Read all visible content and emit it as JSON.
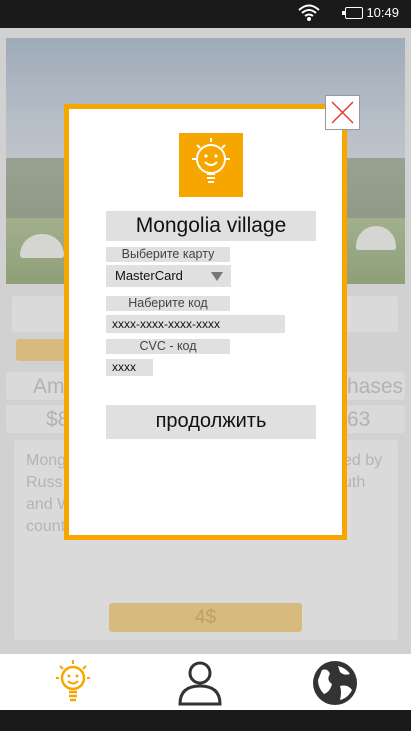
{
  "status_bar": {
    "time": "10:49",
    "icons": [
      "wifi-icon",
      "battery-icon"
    ]
  },
  "background": {
    "image": "mongolia-yurt-landscape",
    "stats_left_label": "Ame",
    "stats_right_label": "hases",
    "stats_left_value": "$8",
    "stats_right_value": "63",
    "description_lines": [
      "Mong",
      "Russ",
      "and W",
      "count"
    ],
    "description_right": [
      "ed by",
      "uth"
    ],
    "price_button": "4$"
  },
  "modal": {
    "title": "Mongolia village",
    "card_label": "Выберите карту",
    "card_selected": "MasterCard",
    "code_label": "Наберите код",
    "code_value": "xxxx-xxxx-xxxx-xxxx",
    "cvc_label": "CVC - код",
    "cvc_value": "xxxx",
    "continue_label": "продолжить"
  },
  "colors": {
    "accent": "#f7a600",
    "muted_orange": "#dfb356",
    "field_bg": "#e0e0e0"
  },
  "nav": [
    {
      "name": "lightbulb-icon",
      "active": true
    },
    {
      "name": "user-icon",
      "active": false
    },
    {
      "name": "globe-icon",
      "active": false
    }
  ]
}
